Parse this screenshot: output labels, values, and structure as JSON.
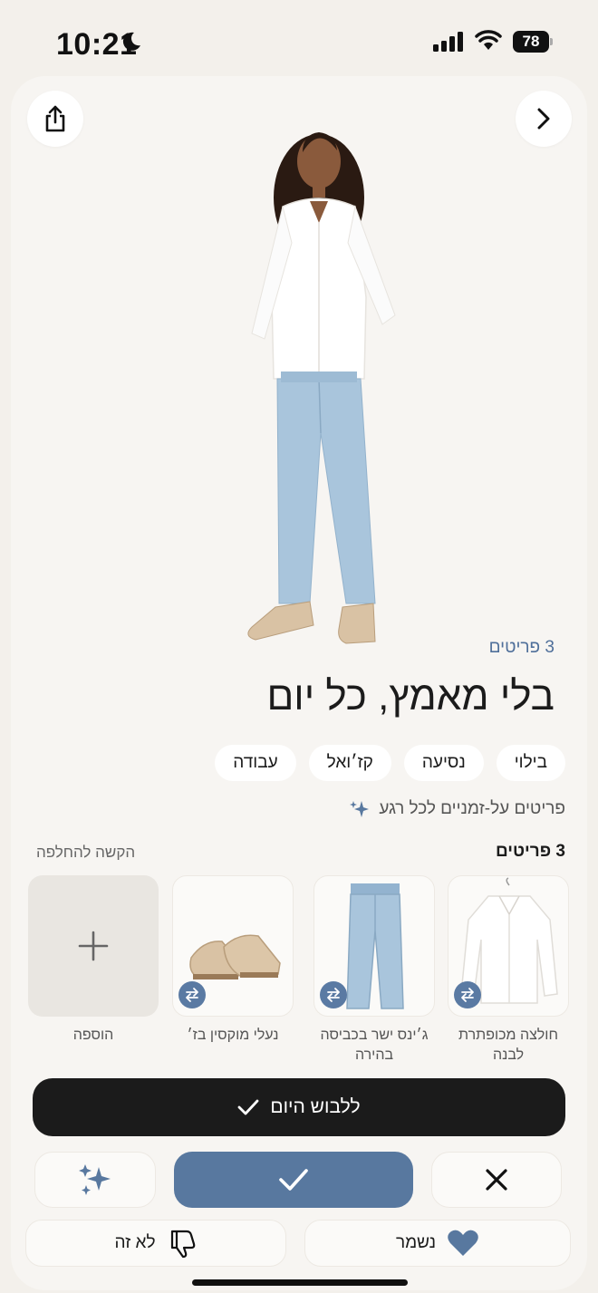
{
  "status": {
    "time": "10:21",
    "battery": "78"
  },
  "outfit": {
    "items_count_label": "3 פריטים",
    "title": "בלי מאמץ, כל יום",
    "tags": [
      "בילוי",
      "נסיעה",
      "קז׳ואל",
      "עבודה"
    ],
    "subtitle": "פריטים על-זמניים לכל רגע"
  },
  "items_section": {
    "header_count": "3 פריטים",
    "hint": "הקשה להחלפה",
    "items": [
      {
        "label": "חולצה מכופתרת לבנה"
      },
      {
        "label": "ג׳ינס ישר בכביסה בהירה"
      },
      {
        "label": "נעלי מוקסין בז׳"
      }
    ],
    "add_label": "הוספה"
  },
  "actions": {
    "wear_today": "ללבוש היום",
    "not_this": "לא זה",
    "saved": "נשמר"
  },
  "colors": {
    "accent": "#58789f",
    "dark": "#1b1b1b",
    "background": "#f3f0eb"
  }
}
